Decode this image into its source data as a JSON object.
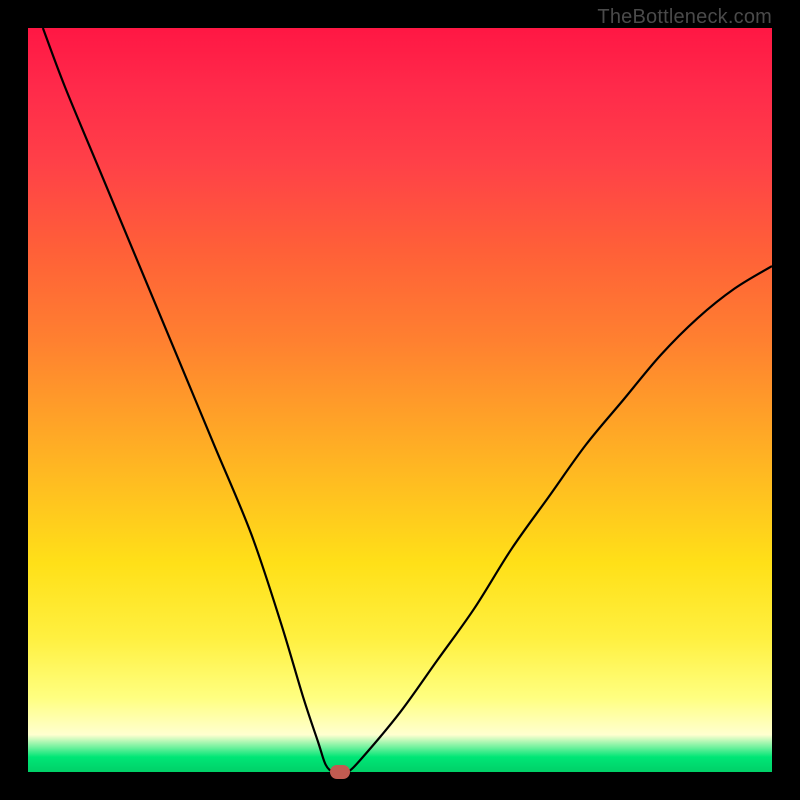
{
  "watermark": "TheBottleneck.com",
  "chart_data": {
    "type": "line",
    "title": "",
    "xlabel": "",
    "ylabel": "",
    "xlim": [
      0,
      100
    ],
    "ylim": [
      0,
      100
    ],
    "grid": false,
    "series": [
      {
        "name": "curve",
        "x": [
          2,
          5,
          10,
          15,
          20,
          25,
          30,
          34,
          37,
          39,
          40,
          41,
          42,
          43,
          45,
          50,
          55,
          60,
          65,
          70,
          75,
          80,
          85,
          90,
          95,
          100
        ],
        "y": [
          100,
          92,
          80,
          68,
          56,
          44,
          32,
          20,
          10,
          4,
          1,
          0,
          0,
          0,
          2,
          8,
          15,
          22,
          30,
          37,
          44,
          50,
          56,
          61,
          65,
          68
        ]
      }
    ],
    "marker": {
      "x": 42,
      "y": 0
    }
  },
  "colors": {
    "frame": "#000000",
    "curve": "#000000",
    "marker": "#c15b51",
    "gradient_top": "#ff1744",
    "gradient_bottom": "#00d068"
  }
}
